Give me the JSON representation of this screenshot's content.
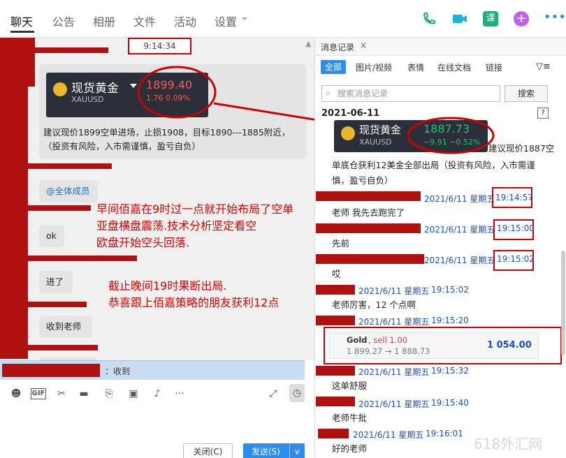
{
  "top_tabs": [
    "聊天",
    "公告",
    "相册",
    "文件",
    "活动",
    "设置"
  ],
  "top_settings_caret": "⌄",
  "chat": {
    "time": "9:14:34",
    "card_name": "现货黄金",
    "card_code": "XAUUSD",
    "card_price": "1899.40",
    "card_change": "1.76   0.09%",
    "msg1": "建议现价1899空单进场，止损1908，目标1890---1885附近，（投资有风险，入市需谨慎，盈亏自负）",
    "msg2": "@全体成员",
    "msg3": "ok",
    "msg4": "进了",
    "msg5": "收到老师",
    "annot1_l1": "早间佰嘉在9时过一点就开始布局了空单",
    "annot1_l2": "亚盘横盘震荡.技术分析坚定看空",
    "annot1_l3": "欧盘开始空头回落.",
    "annot2_l1": "截止晚间19时果断出局.",
    "annot2_l2": "恭喜跟上佰嘉策略的朋友获利12点",
    "reply": "：收到",
    "close_btn": "关闭(C)",
    "send_btn": "发送(S)",
    "send_caret": "∨"
  },
  "right": {
    "title": "消息记录",
    "close": "×",
    "filters": [
      "全部",
      "图片/视频",
      "表情",
      "在线文档",
      "链接"
    ],
    "search_placeholder": "搜索消息记录",
    "search_btn": "搜索",
    "date": "2021-06-11",
    "cal_label": "7",
    "gold_name": "现货黄金",
    "gold_code": "XAUUSD",
    "gold_price": "1887.73",
    "gold_change": "−9.91   −0.52%",
    "msg_close_l1": "建议现价1887空",
    "msg_close_l2": "单底仓获利12美金全部出局（投资有风险，入市需谨",
    "msg_close_l3": "慎，盈亏自负）",
    "entries": [
      {
        "date": "2021/6/11 星期五",
        "time": "19:14:57",
        "text": "老师 我先去跑完了"
      },
      {
        "date": "2021/6/11 星期五",
        "time": "19:15:00",
        "text": "先前"
      },
      {
        "date": "2021/6/11 星期五",
        "time": "19:15:02",
        "text": "哎"
      },
      {
        "date": "2021/6/11 星期五",
        "time": "19:15:02",
        "text": "老师厉害，12 个点啊"
      },
      {
        "date": "2021/6/11 星期五",
        "time": "19:15:20",
        "text": ""
      },
      {
        "date": "2021/6/11 星期五",
        "time": "19:15:32",
        "text": "这单舒服"
      },
      {
        "date": "2021/6/11 星期五",
        "time": "19:15:40",
        "text": "老师牛批"
      },
      {
        "date": "2021/6/11 星期五",
        "time": "19:16:01",
        "text": "好的老师"
      }
    ],
    "trade_title": "Gold",
    "trade_action": ", sell 1.00",
    "trade_prices": "1 899.27 → 1 888.73",
    "trade_profit": "1 054.00"
  },
  "watermark": "618外汇网",
  "colors": {
    "accent": "#2d8cf0",
    "annotation": "#dd0000",
    "mask": "#b01010"
  }
}
